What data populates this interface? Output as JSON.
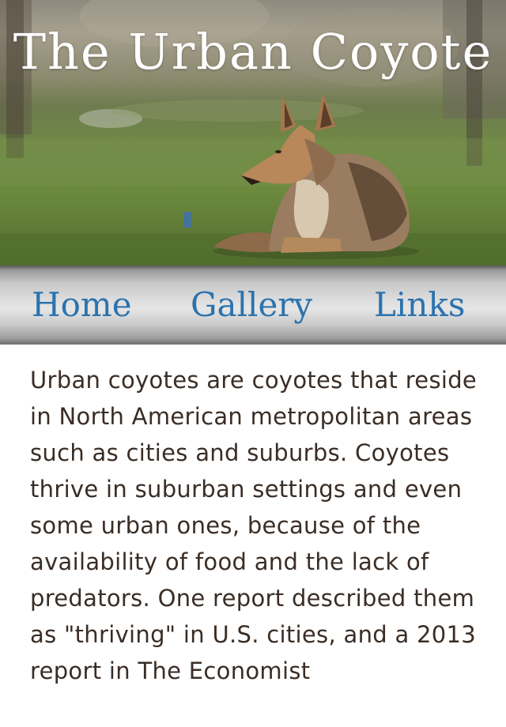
{
  "header": {
    "title": "The Urban Coyote",
    "hero_image": "coyote-resting-on-grass"
  },
  "nav": {
    "items": [
      {
        "label": "Home"
      },
      {
        "label": "Gallery"
      },
      {
        "label": "Links"
      }
    ]
  },
  "main": {
    "intro": "Urban coyotes are coyotes that reside in North American metropolitan areas such as cities and suburbs. Coyotes thrive in suburban settings and even some urban ones, because of the availability of food and the lack of predators. One report described them as \"thriving\" in U.S. cities, and a 2013 report in The Economist"
  },
  "colors": {
    "nav_link": "#2c73ad",
    "body_text": "#3a2d25",
    "title_text": "#ffffff"
  }
}
